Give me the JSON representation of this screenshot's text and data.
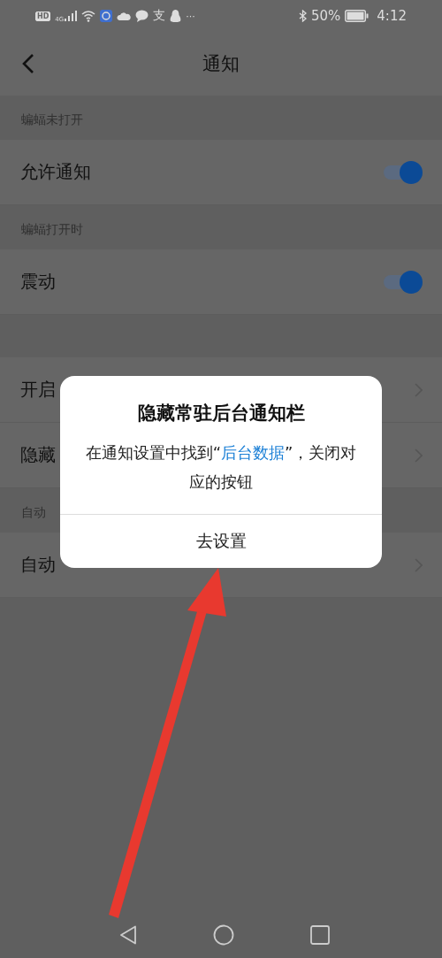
{
  "status_bar": {
    "hd": "HD",
    "network": "4G",
    "app_glyph": "支",
    "more": "···",
    "battery": "50%",
    "time": "4:12"
  },
  "header": {
    "title": "通知"
  },
  "sections": [
    {
      "header": "蝙蝠未打开",
      "rows": [
        {
          "kind": "toggle",
          "label": "允许通知",
          "on": true
        }
      ]
    },
    {
      "header": "蝙蝠打开时",
      "rows": [
        {
          "kind": "toggle",
          "label": "震动",
          "on": true
        }
      ]
    },
    {
      "rows": [
        {
          "kind": "link",
          "label": "开启"
        },
        {
          "kind": "link",
          "label": "隐藏"
        }
      ]
    },
    {
      "header": "自动",
      "rows": [
        {
          "kind": "link",
          "label": "自动"
        }
      ]
    }
  ],
  "dialog": {
    "title": "隐藏常驻后台通知栏",
    "message": [
      {
        "text": "在通知设置中找到“",
        "link": false
      },
      {
        "text": "后台数据",
        "link": true
      },
      {
        "text": "”，关闭对应的按钮",
        "link": false
      }
    ],
    "button": "去设置"
  }
}
